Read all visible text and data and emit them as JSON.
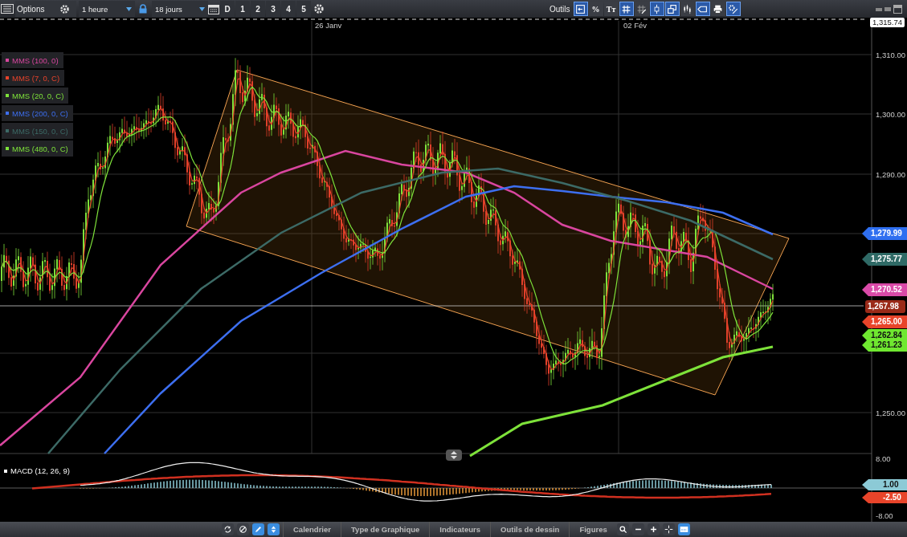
{
  "toolbar": {
    "menu_label": "Options",
    "interval": "1 heure",
    "range": "18 jours",
    "day_buttons": [
      {
        "label": "D"
      },
      {
        "label": "1"
      },
      {
        "label": "2"
      },
      {
        "label": "3"
      },
      {
        "label": "4"
      },
      {
        "label": "5"
      }
    ],
    "tools_label": "Outils",
    "tools": [
      {
        "kind": "exit",
        "on": true
      },
      {
        "kind": "percent",
        "label": "%",
        "on": false
      },
      {
        "kind": "text",
        "label": "Tт",
        "on": false
      },
      {
        "kind": "grid",
        "on": true
      },
      {
        "kind": "grid-pen",
        "on": false
      },
      {
        "kind": "candle",
        "on": true
      },
      {
        "kind": "windows",
        "on": true
      },
      {
        "kind": "candles",
        "on": false
      },
      {
        "kind": "tag",
        "on": true
      },
      {
        "kind": "print",
        "on": false
      },
      {
        "kind": "settings",
        "on": true
      }
    ]
  },
  "chart": {
    "dates": [
      "26 Janv",
      "02 Fév"
    ],
    "top_price": "1,315.74",
    "yticks": [
      "1,310.00",
      "1,300.00",
      "1,290.00",
      "1,250.00"
    ],
    "indicators": [
      {
        "label": "MMS (100, 0)",
        "color": "#d9469f"
      },
      {
        "label": "MMS (7, 0, C)",
        "color": "#e8432b"
      },
      {
        "label": "MMS (20, 0, C)",
        "color": "#7ee23a"
      },
      {
        "label": "MMS (200, 0, C)",
        "color": "#3d6ff0"
      },
      {
        "label": "MMS (150, 0, C)",
        "color": "#3c6a66"
      },
      {
        "label": "MMS (480, 0, C)",
        "color": "#7ee23a"
      }
    ],
    "price_tags": [
      {
        "kind": "arrow",
        "value": "1,279.99",
        "color": "#2f6ff0"
      },
      {
        "kind": "arrow",
        "value": "1,275.77",
        "color": "#2f6a66"
      },
      {
        "kind": "arrow",
        "value": "1,270.52",
        "color": "#d94aa8"
      },
      {
        "kind": "box",
        "value": "1,267.98",
        "color": "#9a2a18"
      },
      {
        "kind": "arrow",
        "value": "1,265.00",
        "color": "#e8442a"
      },
      {
        "kind": "arrow",
        "value": "1,262.84",
        "color": "#6fe830"
      },
      {
        "kind": "arrow",
        "value": "1,261.23",
        "color": "#6fe830"
      }
    ]
  },
  "macd": {
    "label": "MACD (12, 26, 9)",
    "yticks": [
      "8.00",
      "-8.00"
    ],
    "tags": [
      {
        "value": "1.00",
        "color": "#8ccad6"
      },
      {
        "value": "-2.50",
        "color": "#e8442a"
      }
    ]
  },
  "bottom_bar": {
    "left_tools": [
      {
        "kind": "refresh",
        "on": false
      },
      {
        "kind": "ban",
        "on": false
      },
      {
        "kind": "pencil",
        "on": true
      },
      {
        "kind": "updown",
        "on": true
      }
    ],
    "tabs": [
      "Calendrier",
      "Type de Graphique",
      "Indicateurs",
      "Outils de dessin",
      "Figures"
    ],
    "right_tools": [
      {
        "kind": "search",
        "on": false
      },
      {
        "kind": "minus",
        "on": false
      },
      {
        "kind": "plus",
        "on": false
      },
      {
        "kind": "crosshair",
        "on": false
      },
      {
        "kind": "calendar",
        "on": true
      }
    ]
  }
}
